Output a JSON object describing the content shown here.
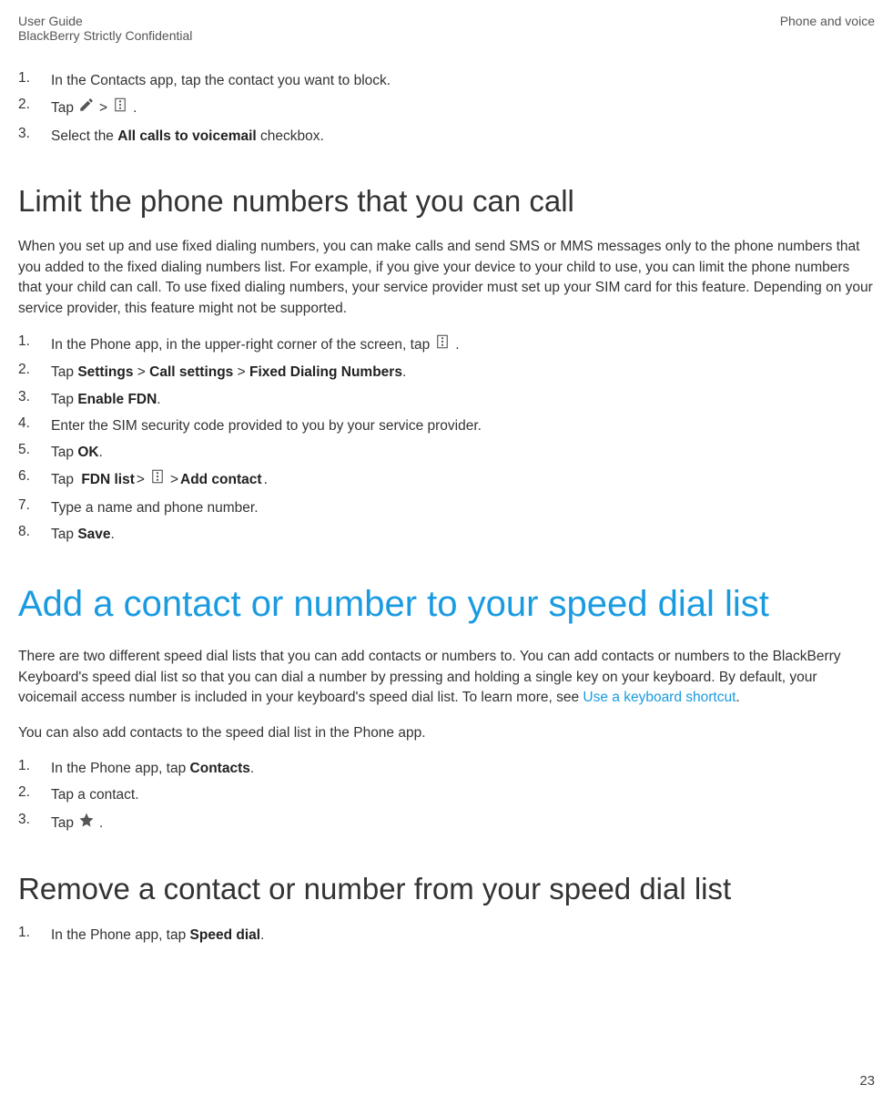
{
  "header": {
    "leftLine1": "User Guide",
    "leftLine2": "BlackBerry Strictly Confidential",
    "right": "Phone and voice"
  },
  "block1": {
    "steps": [
      {
        "num": "1.",
        "text": "In the Contacts app, tap the contact you want to block."
      },
      {
        "num": "2.",
        "prefix": "Tap ",
        "mid": " > ",
        "suffix": "."
      },
      {
        "num": "3.",
        "prefix": "Select the ",
        "bold": "All calls to voicemail",
        "suffix": " checkbox."
      }
    ]
  },
  "section1": {
    "title": "Limit the phone numbers that you can call",
    "para": "When you set up and use fixed dialing numbers, you can make calls and send SMS or MMS messages only to the phone numbers that you added to the fixed dialing numbers list. For example, if you give your device to your child to use, you can limit the phone numbers that your child can call. To use fixed dialing numbers, your service provider must set up your SIM card for this feature. Depending on your service provider, this feature might not be supported.",
    "steps": [
      {
        "num": "1.",
        "prefix": "In the Phone app, in the upper-right corner of the screen, tap ",
        "suffix": "."
      },
      {
        "num": "2.",
        "prefix": "Tap ",
        "b1": "Settings",
        "s1": " > ",
        "b2": "Call settings",
        "s2": " > ",
        "b3": "Fixed Dialing Numbers",
        "suffix": "."
      },
      {
        "num": "3.",
        "prefix": "Tap ",
        "b1": "Enable FDN",
        "suffix": "."
      },
      {
        "num": "4.",
        "text": "Enter the SIM security code provided to you by your service provider."
      },
      {
        "num": "5.",
        "prefix": "Tap ",
        "b1": "OK",
        "suffix": "."
      },
      {
        "num": "6.",
        "prefix": "Tap ",
        "b1": "FDN list",
        "s1": " > ",
        "s2": " > ",
        "b2": "Add contact",
        "suffix": "."
      },
      {
        "num": "7.",
        "text": "Type a name and phone number."
      },
      {
        "num": "8.",
        "prefix": "Tap ",
        "b1": "Save",
        "suffix": "."
      }
    ]
  },
  "section2": {
    "title": "Add a contact or number to your speed dial list",
    "para1_a": "There are two different speed dial lists that you can add contacts or numbers to. You can add contacts or numbers to the BlackBerry Keyboard's speed dial list so that you can dial a number by pressing and holding a single key on your keyboard. By default, your voicemail access number is included in your keyboard's speed dial list. To learn more, see ",
    "para1_link": "Use a keyboard shortcut",
    "para1_b": ".",
    "para2": "You can also add contacts to the speed dial list in the Phone app.",
    "steps": [
      {
        "num": "1.",
        "prefix": "In the Phone app, tap ",
        "b1": "Contacts",
        "suffix": "."
      },
      {
        "num": "2.",
        "text": "Tap a contact."
      },
      {
        "num": "3.",
        "prefix": "Tap ",
        "suffix": "."
      }
    ]
  },
  "section3": {
    "title": "Remove a contact or number from your speed dial list",
    "steps": [
      {
        "num": "1.",
        "prefix": "In the Phone app, tap ",
        "b1": "Speed dial",
        "suffix": "."
      }
    ]
  },
  "pageNumber": "23"
}
